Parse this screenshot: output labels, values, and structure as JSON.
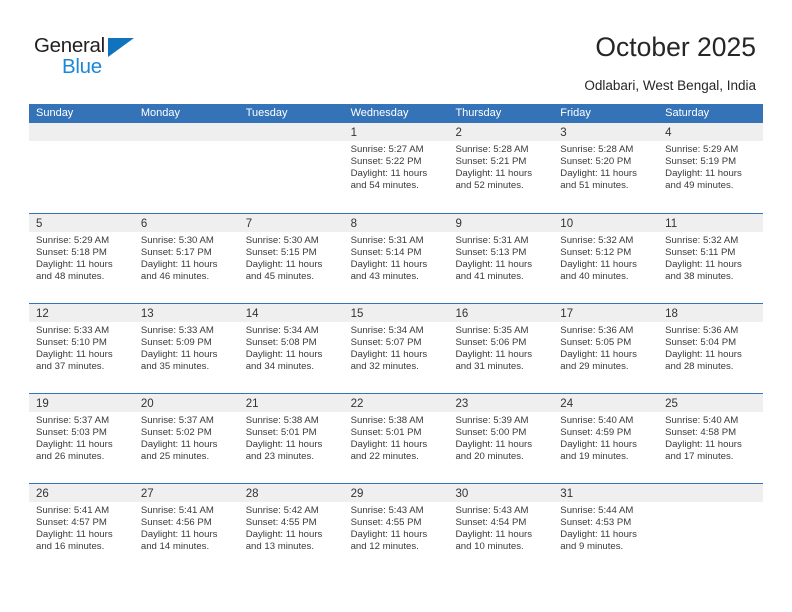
{
  "brand": {
    "name_part1": "General",
    "name_part2": "Blue",
    "triangle_icon": "triangle-icon",
    "colors": {
      "dark": "#231f20",
      "blue": "#1b87d8",
      "triangle": "#0f73bd"
    }
  },
  "header": {
    "title": "October 2025",
    "subtitle": "Odlabari, West Bengal, India"
  },
  "theme": {
    "header_blue": "#3573b9",
    "date_band_gray": "#efefef",
    "cell_white": "#ffffff",
    "text": "#3a3a3a"
  },
  "weekday_headers": [
    "Sunday",
    "Monday",
    "Tuesday",
    "Wednesday",
    "Thursday",
    "Friday",
    "Saturday"
  ],
  "labels": {
    "sunrise_prefix": "Sunrise:",
    "sunset_prefix": "Sunset:",
    "daylight_prefix": "Daylight:"
  },
  "weeks": [
    [
      {
        "day": "",
        "empty": true
      },
      {
        "day": "",
        "empty": true
      },
      {
        "day": "",
        "empty": true
      },
      {
        "day": "1",
        "sunrise": "Sunrise: 5:27 AM",
        "sunset": "Sunset: 5:22 PM",
        "daylight_line1": "Daylight: 11 hours",
        "daylight_line2": "and 54 minutes."
      },
      {
        "day": "2",
        "sunrise": "Sunrise: 5:28 AM",
        "sunset": "Sunset: 5:21 PM",
        "daylight_line1": "Daylight: 11 hours",
        "daylight_line2": "and 52 minutes."
      },
      {
        "day": "3",
        "sunrise": "Sunrise: 5:28 AM",
        "sunset": "Sunset: 5:20 PM",
        "daylight_line1": "Daylight: 11 hours",
        "daylight_line2": "and 51 minutes."
      },
      {
        "day": "4",
        "sunrise": "Sunrise: 5:29 AM",
        "sunset": "Sunset: 5:19 PM",
        "daylight_line1": "Daylight: 11 hours",
        "daylight_line2": "and 49 minutes."
      }
    ],
    [
      {
        "day": "5",
        "sunrise": "Sunrise: 5:29 AM",
        "sunset": "Sunset: 5:18 PM",
        "daylight_line1": "Daylight: 11 hours",
        "daylight_line2": "and 48 minutes."
      },
      {
        "day": "6",
        "sunrise": "Sunrise: 5:30 AM",
        "sunset": "Sunset: 5:17 PM",
        "daylight_line1": "Daylight: 11 hours",
        "daylight_line2": "and 46 minutes."
      },
      {
        "day": "7",
        "sunrise": "Sunrise: 5:30 AM",
        "sunset": "Sunset: 5:15 PM",
        "daylight_line1": "Daylight: 11 hours",
        "daylight_line2": "and 45 minutes."
      },
      {
        "day": "8",
        "sunrise": "Sunrise: 5:31 AM",
        "sunset": "Sunset: 5:14 PM",
        "daylight_line1": "Daylight: 11 hours",
        "daylight_line2": "and 43 minutes."
      },
      {
        "day": "9",
        "sunrise": "Sunrise: 5:31 AM",
        "sunset": "Sunset: 5:13 PM",
        "daylight_line1": "Daylight: 11 hours",
        "daylight_line2": "and 41 minutes."
      },
      {
        "day": "10",
        "sunrise": "Sunrise: 5:32 AM",
        "sunset": "Sunset: 5:12 PM",
        "daylight_line1": "Daylight: 11 hours",
        "daylight_line2": "and 40 minutes."
      },
      {
        "day": "11",
        "sunrise": "Sunrise: 5:32 AM",
        "sunset": "Sunset: 5:11 PM",
        "daylight_line1": "Daylight: 11 hours",
        "daylight_line2": "and 38 minutes."
      }
    ],
    [
      {
        "day": "12",
        "sunrise": "Sunrise: 5:33 AM",
        "sunset": "Sunset: 5:10 PM",
        "daylight_line1": "Daylight: 11 hours",
        "daylight_line2": "and 37 minutes."
      },
      {
        "day": "13",
        "sunrise": "Sunrise: 5:33 AM",
        "sunset": "Sunset: 5:09 PM",
        "daylight_line1": "Daylight: 11 hours",
        "daylight_line2": "and 35 minutes."
      },
      {
        "day": "14",
        "sunrise": "Sunrise: 5:34 AM",
        "sunset": "Sunset: 5:08 PM",
        "daylight_line1": "Daylight: 11 hours",
        "daylight_line2": "and 34 minutes."
      },
      {
        "day": "15",
        "sunrise": "Sunrise: 5:34 AM",
        "sunset": "Sunset: 5:07 PM",
        "daylight_line1": "Daylight: 11 hours",
        "daylight_line2": "and 32 minutes."
      },
      {
        "day": "16",
        "sunrise": "Sunrise: 5:35 AM",
        "sunset": "Sunset: 5:06 PM",
        "daylight_line1": "Daylight: 11 hours",
        "daylight_line2": "and 31 minutes."
      },
      {
        "day": "17",
        "sunrise": "Sunrise: 5:36 AM",
        "sunset": "Sunset: 5:05 PM",
        "daylight_line1": "Daylight: 11 hours",
        "daylight_line2": "and 29 minutes."
      },
      {
        "day": "18",
        "sunrise": "Sunrise: 5:36 AM",
        "sunset": "Sunset: 5:04 PM",
        "daylight_line1": "Daylight: 11 hours",
        "daylight_line2": "and 28 minutes."
      }
    ],
    [
      {
        "day": "19",
        "sunrise": "Sunrise: 5:37 AM",
        "sunset": "Sunset: 5:03 PM",
        "daylight_line1": "Daylight: 11 hours",
        "daylight_line2": "and 26 minutes."
      },
      {
        "day": "20",
        "sunrise": "Sunrise: 5:37 AM",
        "sunset": "Sunset: 5:02 PM",
        "daylight_line1": "Daylight: 11 hours",
        "daylight_line2": "and 25 minutes."
      },
      {
        "day": "21",
        "sunrise": "Sunrise: 5:38 AM",
        "sunset": "Sunset: 5:01 PM",
        "daylight_line1": "Daylight: 11 hours",
        "daylight_line2": "and 23 minutes."
      },
      {
        "day": "22",
        "sunrise": "Sunrise: 5:38 AM",
        "sunset": "Sunset: 5:01 PM",
        "daylight_line1": "Daylight: 11 hours",
        "daylight_line2": "and 22 minutes."
      },
      {
        "day": "23",
        "sunrise": "Sunrise: 5:39 AM",
        "sunset": "Sunset: 5:00 PM",
        "daylight_line1": "Daylight: 11 hours",
        "daylight_line2": "and 20 minutes."
      },
      {
        "day": "24",
        "sunrise": "Sunrise: 5:40 AM",
        "sunset": "Sunset: 4:59 PM",
        "daylight_line1": "Daylight: 11 hours",
        "daylight_line2": "and 19 minutes."
      },
      {
        "day": "25",
        "sunrise": "Sunrise: 5:40 AM",
        "sunset": "Sunset: 4:58 PM",
        "daylight_line1": "Daylight: 11 hours",
        "daylight_line2": "and 17 minutes."
      }
    ],
    [
      {
        "day": "26",
        "sunrise": "Sunrise: 5:41 AM",
        "sunset": "Sunset: 4:57 PM",
        "daylight_line1": "Daylight: 11 hours",
        "daylight_line2": "and 16 minutes."
      },
      {
        "day": "27",
        "sunrise": "Sunrise: 5:41 AM",
        "sunset": "Sunset: 4:56 PM",
        "daylight_line1": "Daylight: 11 hours",
        "daylight_line2": "and 14 minutes."
      },
      {
        "day": "28",
        "sunrise": "Sunrise: 5:42 AM",
        "sunset": "Sunset: 4:55 PM",
        "daylight_line1": "Daylight: 11 hours",
        "daylight_line2": "and 13 minutes."
      },
      {
        "day": "29",
        "sunrise": "Sunrise: 5:43 AM",
        "sunset": "Sunset: 4:55 PM",
        "daylight_line1": "Daylight: 11 hours",
        "daylight_line2": "and 12 minutes."
      },
      {
        "day": "30",
        "sunrise": "Sunrise: 5:43 AM",
        "sunset": "Sunset: 4:54 PM",
        "daylight_line1": "Daylight: 11 hours",
        "daylight_line2": "and 10 minutes."
      },
      {
        "day": "31",
        "sunrise": "Sunrise: 5:44 AM",
        "sunset": "Sunset: 4:53 PM",
        "daylight_line1": "Daylight: 11 hours",
        "daylight_line2": "and 9 minutes."
      },
      {
        "day": "",
        "empty": true
      }
    ]
  ]
}
